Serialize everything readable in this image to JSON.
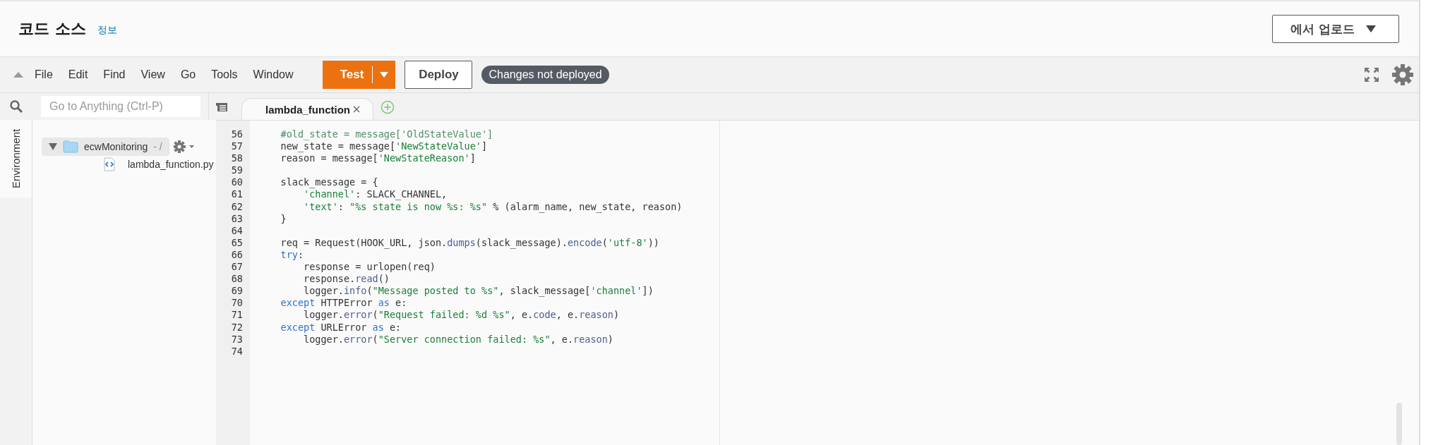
{
  "header": {
    "title": "코드 소스",
    "info_link": "정보",
    "upload_button": "에서 업로드"
  },
  "menu": [
    "File",
    "Edit",
    "Find",
    "View",
    "Go",
    "Tools",
    "Window"
  ],
  "actions": {
    "test_button": "Test",
    "deploy_button": "Deploy",
    "status_badge": "Changes not deployed"
  },
  "sidebar": {
    "search": {
      "placeholder": "Go to Anything (Ctrl-P)"
    },
    "side_tab": {
      "label": "Environment",
      "selected": true
    },
    "tree": [
      {
        "name": "ecwMonitoring",
        "path": "- /",
        "kind": "folder",
        "expanded": true,
        "selected": true,
        "children": [
          {
            "name": "lambda_function.py",
            "kind": "file",
            "selected": false
          }
        ]
      }
    ]
  },
  "tabs": [
    {
      "label": "lambda_function",
      "selected": true
    }
  ],
  "code_lines": [
    {
      "number": "56",
      "tokens": [
        {
          "text": "    #old_state = message['OldStateValue']",
          "kind": "comment"
        }
      ]
    },
    {
      "number": "57",
      "tokens": [
        {
          "text": "    new_state = message[",
          "kind": "plain"
        },
        {
          "text": "'NewStateValue'",
          "kind": "string"
        },
        {
          "text": "]",
          "kind": "plain"
        }
      ]
    },
    {
      "number": "58",
      "tokens": [
        {
          "text": "    reason = message[",
          "kind": "plain"
        },
        {
          "text": "'NewStateReason'",
          "kind": "string"
        },
        {
          "text": "]",
          "kind": "plain"
        }
      ]
    },
    {
      "number": "59"
    },
    {
      "number": "60",
      "tokens": [
        {
          "text": "    slack_message = {",
          "kind": "plain"
        }
      ]
    },
    {
      "number": "61",
      "tokens": [
        {
          "text": "        'channel'",
          "kind": "string"
        },
        {
          "text": ": SLACK_CHANNEL,",
          "kind": "plain"
        }
      ]
    },
    {
      "number": "62",
      "tokens": [
        {
          "text": "        'text'",
          "kind": "string"
        },
        {
          "text": ": ",
          "kind": "plain"
        },
        {
          "text": "\"%s state is now %s: %s\"",
          "kind": "string"
        },
        {
          "text": " % (alarm_name, new_state, reason)",
          "kind": "plain"
        }
      ]
    },
    {
      "number": "63",
      "tokens": [
        {
          "text": "    }",
          "kind": "plain"
        }
      ]
    },
    {
      "number": "64"
    },
    {
      "number": "65",
      "tokens": [
        {
          "text": "    req = Request(HOOK_URL, json.",
          "kind": "plain"
        },
        {
          "text": "dumps",
          "kind": "method"
        },
        {
          "text": "(slack_message).",
          "kind": "plain"
        },
        {
          "text": "encode",
          "kind": "method"
        },
        {
          "text": "(",
          "kind": "plain"
        },
        {
          "text": "'utf-8'",
          "kind": "string"
        },
        {
          "text": "))",
          "kind": "plain"
        }
      ]
    },
    {
      "number": "66",
      "tokens": [
        {
          "text": "    try",
          "kind": "keyword"
        },
        {
          "text": ":",
          "kind": "plain"
        }
      ]
    },
    {
      "number": "67",
      "tokens": [
        {
          "text": "        response = urlopen(req)",
          "kind": "plain"
        }
      ]
    },
    {
      "number": "68",
      "tokens": [
        {
          "text": "        response.",
          "kind": "plain"
        },
        {
          "text": "read",
          "kind": "method"
        },
        {
          "text": "()",
          "kind": "plain"
        }
      ]
    },
    {
      "number": "69",
      "tokens": [
        {
          "text": "        logger.",
          "kind": "plain"
        },
        {
          "text": "info",
          "kind": "method"
        },
        {
          "text": "(",
          "kind": "plain"
        },
        {
          "text": "\"Message posted to %s\"",
          "kind": "string"
        },
        {
          "text": ", slack_message[",
          "kind": "plain"
        },
        {
          "text": "'channel'",
          "kind": "string"
        },
        {
          "text": "])",
          "kind": "plain"
        }
      ]
    },
    {
      "number": "70",
      "tokens": [
        {
          "text": "    except",
          "kind": "keyword"
        },
        {
          "text": " HTTPError ",
          "kind": "plain"
        },
        {
          "text": "as",
          "kind": "keyword"
        },
        {
          "text": " e:",
          "kind": "plain"
        }
      ]
    },
    {
      "number": "71",
      "tokens": [
        {
          "text": "        logger.",
          "kind": "plain"
        },
        {
          "text": "error",
          "kind": "method"
        },
        {
          "text": "(",
          "kind": "plain"
        },
        {
          "text": "\"Request failed: %d %s\"",
          "kind": "string"
        },
        {
          "text": ", e.",
          "kind": "plain"
        },
        {
          "text": "code",
          "kind": "method"
        },
        {
          "text": ", e.",
          "kind": "plain"
        },
        {
          "text": "reason",
          "kind": "method"
        },
        {
          "text": ")",
          "kind": "plain"
        }
      ]
    },
    {
      "number": "72",
      "tokens": [
        {
          "text": "    except",
          "kind": "keyword"
        },
        {
          "text": " URLError ",
          "kind": "plain"
        },
        {
          "text": "as",
          "kind": "keyword"
        },
        {
          "text": " e:",
          "kind": "plain"
        }
      ]
    },
    {
      "number": "73",
      "tokens": [
        {
          "text": "        logger.",
          "kind": "plain"
        },
        {
          "text": "error",
          "kind": "method"
        },
        {
          "text": "(",
          "kind": "plain"
        },
        {
          "text": "\"Server connection failed: %s\"",
          "kind": "string"
        },
        {
          "text": ", e.",
          "kind": "plain"
        },
        {
          "text": "reason",
          "kind": "method"
        },
        {
          "text": ")",
          "kind": "plain"
        }
      ]
    },
    {
      "number": "74"
    }
  ]
}
